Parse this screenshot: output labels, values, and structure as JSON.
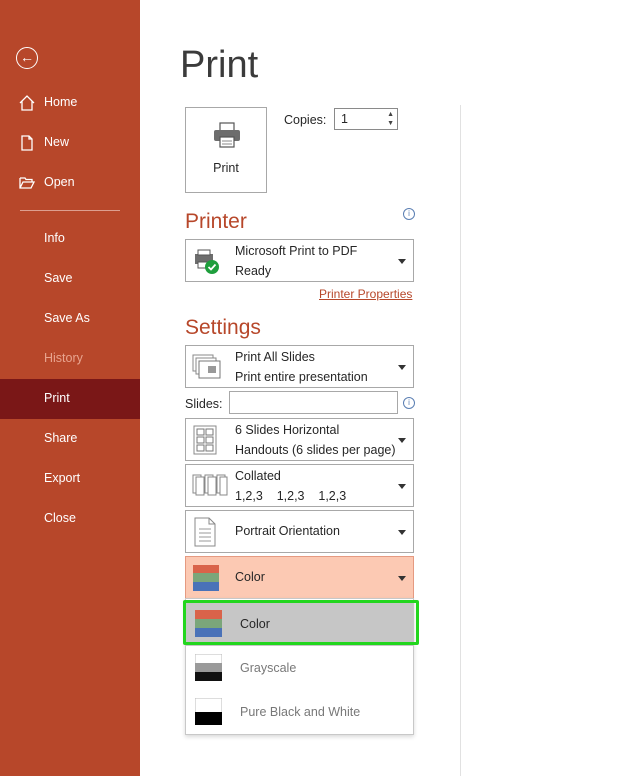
{
  "sidebar": {
    "items": [
      {
        "label": "Home",
        "icon": "home-icon"
      },
      {
        "label": "New",
        "icon": "new-document-icon"
      },
      {
        "label": "Open",
        "icon": "open-folder-icon"
      },
      {
        "label": "Info"
      },
      {
        "label": "Save"
      },
      {
        "label": "Save As"
      },
      {
        "label": "History",
        "disabled": true
      },
      {
        "label": "Print",
        "active": true
      },
      {
        "label": "Share"
      },
      {
        "label": "Export"
      },
      {
        "label": "Close"
      }
    ],
    "accent_color": "#b7472a",
    "active_color": "#7a1717"
  },
  "page": {
    "title": "Print",
    "print_button_label": "Print",
    "copies_label": "Copies:",
    "copies_value": "1"
  },
  "printer": {
    "heading": "Printer",
    "name": "Microsoft Print to PDF",
    "status": "Ready",
    "properties_link": "Printer Properties"
  },
  "settings": {
    "heading": "Settings",
    "range_title": "Print All Slides",
    "range_sub": "Print entire presentation",
    "slides_label": "Slides:",
    "slides_value": "",
    "layout_title": "6 Slides Horizontal",
    "layout_sub": "Handouts (6 slides per page)",
    "collate_title": "Collated",
    "collate_sub": "1,2,3    1,2,3    1,2,3",
    "orientation": "Portrait Orientation",
    "color_selected": "Color"
  },
  "color_menu": {
    "options": [
      {
        "label": "Color"
      },
      {
        "label": "Grayscale"
      },
      {
        "label": "Pure Black and White"
      }
    ],
    "highlight_color": "#22d61e"
  }
}
